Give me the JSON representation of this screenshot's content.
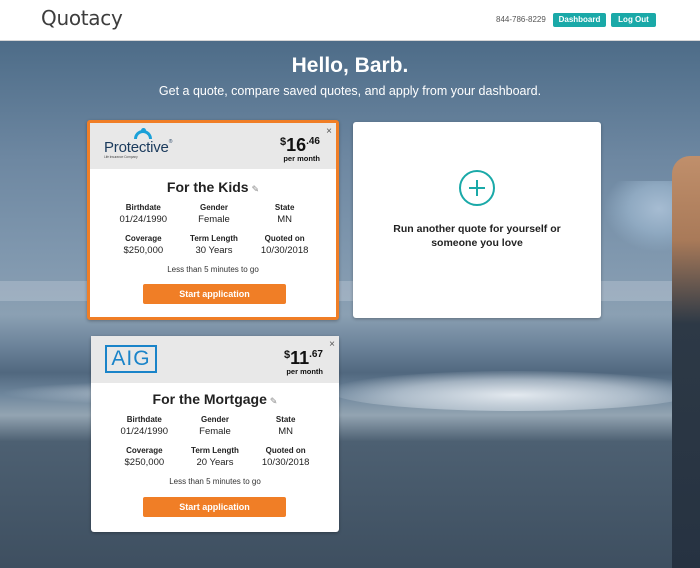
{
  "header": {
    "logo": "Quotacy",
    "phone": "844-786-8229",
    "dashboard_label": "Dashboard",
    "logout_label": "Log Out"
  },
  "hero": {
    "title": "Hello, Barb.",
    "subtitle": "Get a quote, compare saved quotes, and apply from your dashboard."
  },
  "quotes": [
    {
      "carrier": "Protective",
      "carrier_tagline": "Life Insurance Company",
      "price_dollar": "$",
      "price_int": "16",
      "price_cents": ".46",
      "per": "per month",
      "name": "For the Kids",
      "birthdate_label": "Birthdate",
      "birthdate": "01/24/1990",
      "gender_label": "Gender",
      "gender": "Female",
      "state_label": "State",
      "state": "MN",
      "coverage_label": "Coverage",
      "coverage": "$250,000",
      "term_label": "Term Length",
      "term": "30 Years",
      "quoted_label": "Quoted on",
      "quoted": "10/30/2018",
      "note": "Less than 5 minutes to go",
      "apply_label": "Start application"
    },
    {
      "carrier": "AIG",
      "price_dollar": "$",
      "price_int": "11",
      "price_cents": ".67",
      "per": "per month",
      "name": "For the Mortgage",
      "birthdate_label": "Birthdate",
      "birthdate": "01/24/1990",
      "gender_label": "Gender",
      "gender": "Female",
      "state_label": "State",
      "state": "MN",
      "coverage_label": "Coverage",
      "coverage": "$250,000",
      "term_label": "Term Length",
      "term": "20 Years",
      "quoted_label": "Quoted on",
      "quoted": "10/30/2018",
      "note": "Less than 5 minutes to go",
      "apply_label": "Start application"
    }
  ],
  "add_card": {
    "text": "Run another quote for yourself or someone you love"
  },
  "icons": {
    "close": "×",
    "pencil": "✎",
    "trademark": "®"
  },
  "colors": {
    "accent_teal": "#1aa9a8",
    "accent_orange": "#f07e26",
    "brand_blue": "#1a84c9"
  }
}
